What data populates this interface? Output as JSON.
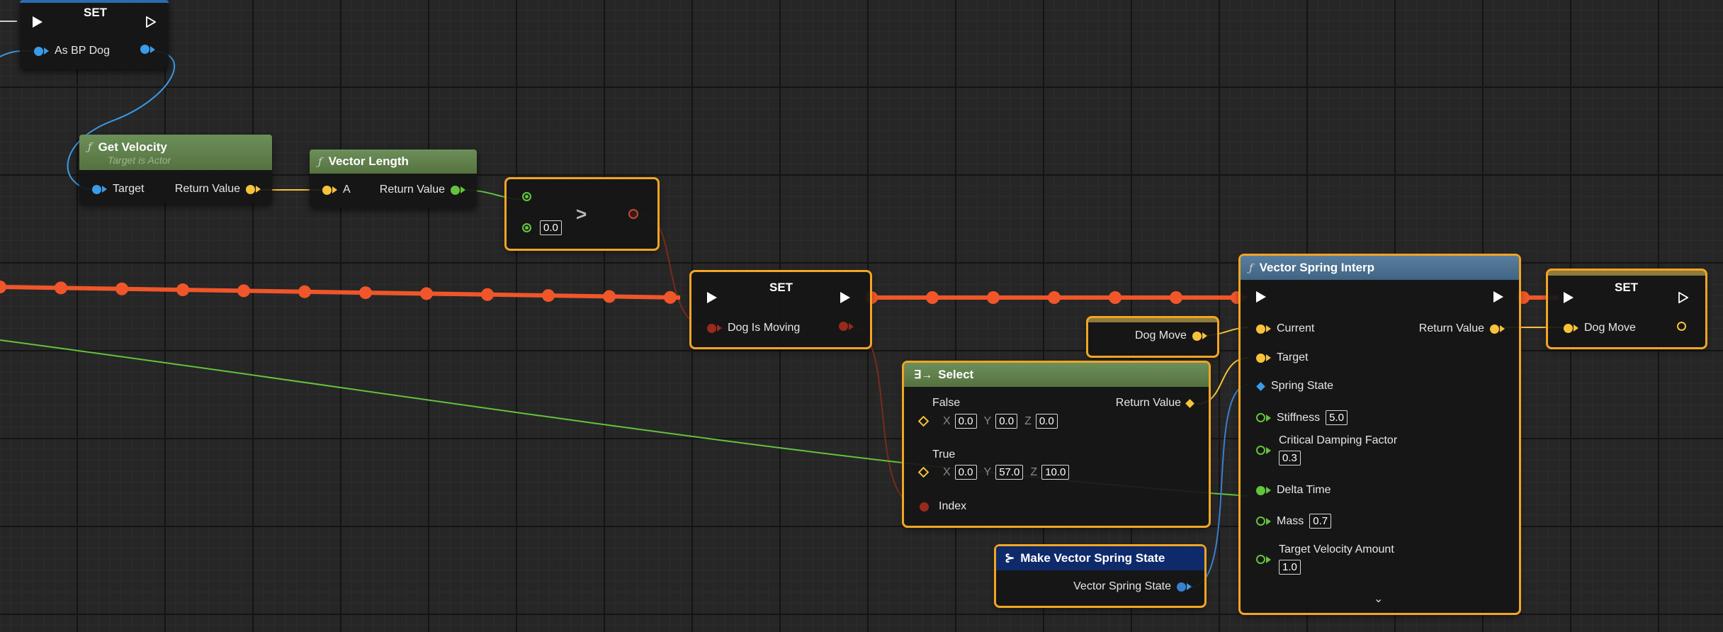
{
  "colors": {
    "exec_wire": "#f0562a",
    "vector_pin": "#f7c23b",
    "object_pin": "#3a9be8",
    "float_pin": "#63c33c",
    "bool_pin": "#9a2a1c",
    "selection": "#f2a524"
  },
  "set_top": {
    "title": "SET",
    "pin": "As BP Dog"
  },
  "get_velocity": {
    "title": "Get Velocity",
    "subtitle": "Target is Actor",
    "in": "Target",
    "out": "Return Value"
  },
  "vector_length": {
    "title": "Vector Length",
    "in": "A",
    "out": "Return Value"
  },
  "compare": {
    "op": ">",
    "value": "0.0"
  },
  "set_moving": {
    "title": "SET",
    "pin": "Dog Is Moving"
  },
  "dog_move_get": {
    "label": "Dog Move"
  },
  "select": {
    "title": "Select",
    "false_label": "False",
    "true_label": "True",
    "index_label": "Index",
    "out": "Return Value",
    "false_x": "0.0",
    "false_y": "0.0",
    "false_z": "0.0",
    "true_x": "0.0",
    "true_y": "57.0",
    "true_z": "10.0",
    "x": "X",
    "y": "Y",
    "z": "Z"
  },
  "make_spring": {
    "title": "Make Vector Spring State",
    "out": "Vector Spring State"
  },
  "spring_interp": {
    "title": "Vector Spring Interp",
    "current": "Current",
    "target": "Target",
    "spring_state": "Spring State",
    "stiffness": "Stiffness",
    "stiffness_val": "5.0",
    "damping": "Critical Damping Factor",
    "damping_val": "0.3",
    "delta": "Delta Time",
    "mass": "Mass",
    "mass_val": "0.7",
    "tva": "Target Velocity Amount",
    "tva_val": "1.0",
    "out": "Return Value"
  },
  "set_dogmove": {
    "title": "SET",
    "pin": "Dog Move"
  }
}
